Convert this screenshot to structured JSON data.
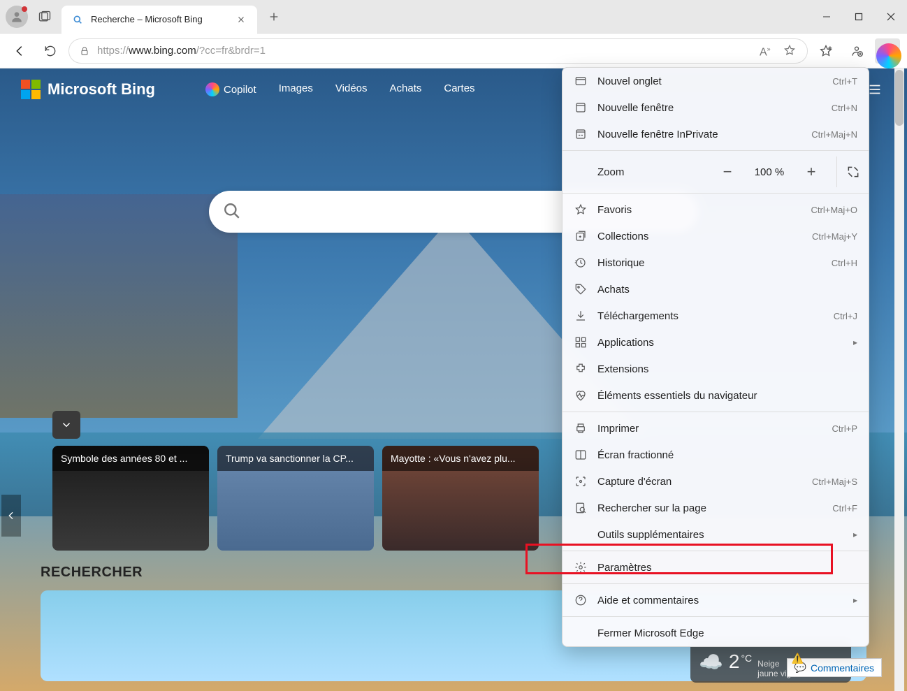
{
  "tab": {
    "title": "Recherche – Microsoft Bing"
  },
  "url": {
    "proto": "https://",
    "host": "www.bing.com",
    "path": "/?cc=fr&brdr=1"
  },
  "bing": {
    "brand": "Microsoft Bing",
    "nav": {
      "copilot": "Copilot",
      "images": "Images",
      "videos": "Vidéos",
      "shop": "Achats",
      "maps": "Cartes"
    },
    "rechercher": "RECHERCHER"
  },
  "news": {
    "c1": "Symbole des années 80 et ...",
    "c2": "Trump va sanctionner la CP...",
    "c3": "Mayotte : «Vous n'avez plu..."
  },
  "weather": {
    "temp": "2",
    "unit": "°C",
    "cond": "Neige",
    "region": "jaune vigilance"
  },
  "feedback": {
    "label": "Commentaires"
  },
  "menu": {
    "new_tab": "Nouvel onglet",
    "new_tab_sc": "Ctrl+T",
    "new_win": "Nouvelle fenêtre",
    "new_win_sc": "Ctrl+N",
    "inprivate": "Nouvelle fenêtre InPrivate",
    "inprivate_sc": "Ctrl+Maj+N",
    "zoom": "Zoom",
    "zoom_val": "100 %",
    "favorites": "Favoris",
    "favorites_sc": "Ctrl+Maj+O",
    "collections": "Collections",
    "collections_sc": "Ctrl+Maj+Y",
    "history": "Historique",
    "history_sc": "Ctrl+H",
    "purchases": "Achats",
    "downloads": "Téléchargements",
    "downloads_sc": "Ctrl+J",
    "apps": "Applications",
    "extensions": "Extensions",
    "essentials": "Éléments essentiels du navigateur",
    "print": "Imprimer",
    "print_sc": "Ctrl+P",
    "split": "Écran fractionné",
    "screenshot": "Capture d'écran",
    "screenshot_sc": "Ctrl+Maj+S",
    "find": "Rechercher sur la page",
    "find_sc": "Ctrl+F",
    "moretools": "Outils supplémentaires",
    "settings": "Paramètres",
    "help": "Aide et commentaires",
    "close": "Fermer Microsoft Edge"
  }
}
